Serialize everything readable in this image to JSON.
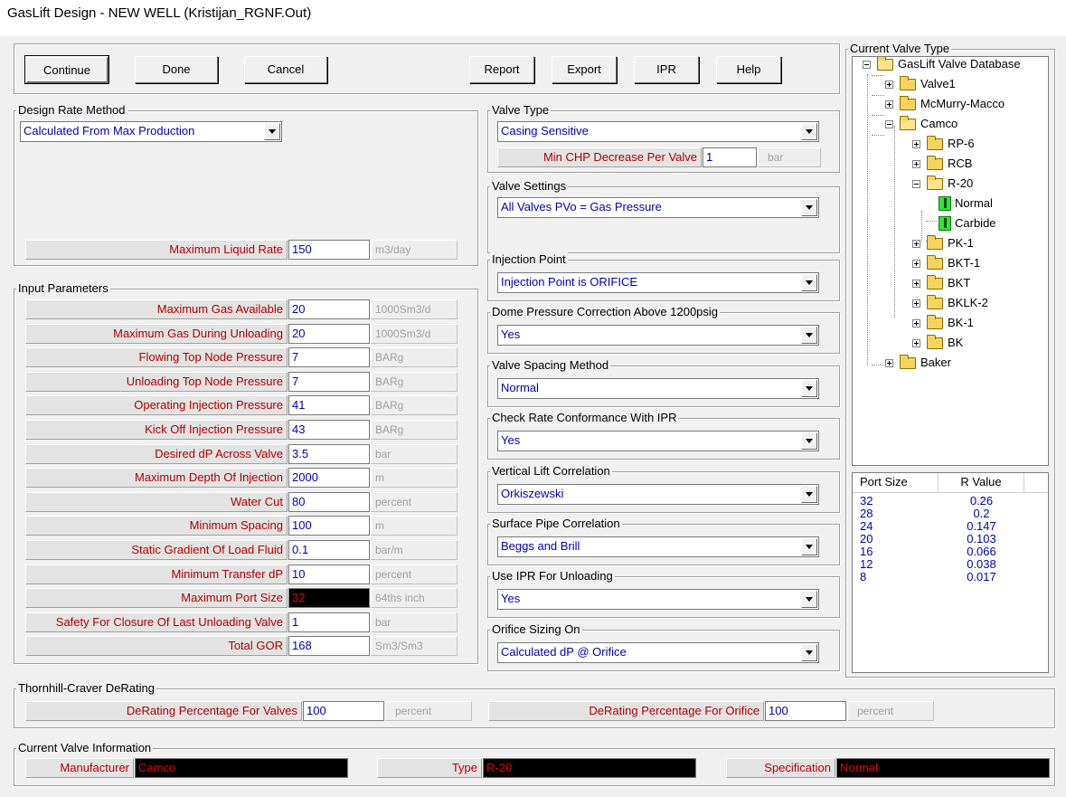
{
  "window": {
    "title": "GasLift Design - NEW WELL (Kristijan_RGNF.Out)"
  },
  "toolbar": {
    "continue": "Continue",
    "done": "Done",
    "cancel": "Cancel",
    "report": "Report",
    "export": "Export",
    "ipr": "IPR",
    "help": "Help"
  },
  "design_rate": {
    "title": "Design Rate Method",
    "method": "Calculated From Max Production",
    "max_liquid_label": "Maximum Liquid Rate",
    "max_liquid_value": "150",
    "max_liquid_unit": "m3/day"
  },
  "input_params": {
    "title": "Input Parameters",
    "rows": [
      {
        "label": "Maximum Gas Available",
        "value": "20",
        "unit": "1000Sm3/d"
      },
      {
        "label": "Maximum Gas During Unloading",
        "value": "20",
        "unit": "1000Sm3/d"
      },
      {
        "label": "Flowing Top Node Pressure",
        "value": "7",
        "unit": "BARg"
      },
      {
        "label": "Unloading Top Node Pressure",
        "value": "7",
        "unit": "BARg"
      },
      {
        "label": "Operating Injection Pressure",
        "value": "41",
        "unit": "BARg"
      },
      {
        "label": "Kick Off Injection Pressure",
        "value": "43",
        "unit": "BARg"
      },
      {
        "label": "Desired dP Across Valve",
        "value": "3.5",
        "unit": "bar"
      },
      {
        "label": "Maximum Depth Of Injection",
        "value": "2000",
        "unit": "m"
      },
      {
        "label": "Water Cut",
        "value": "80",
        "unit": "percent"
      },
      {
        "label": "Minimum Spacing",
        "value": "100",
        "unit": "m"
      },
      {
        "label": "Static Gradient Of Load Fluid",
        "value": "0.1",
        "unit": "bar/m"
      },
      {
        "label": "Minimum Transfer dP",
        "value": "10",
        "unit": "percent"
      },
      {
        "label": "Maximum Port Size",
        "value": "32",
        "unit": "64ths inch"
      },
      {
        "label": "Safety For Closure Of Last Unloading Valve",
        "value": "1",
        "unit": "bar"
      },
      {
        "label": "Total GOR",
        "value": "168",
        "unit": "Sm3/Sm3"
      }
    ]
  },
  "valve_type": {
    "title": "Valve Type",
    "value": "Casing Sensitive",
    "min_chp_label": "Min CHP Decrease Per Valve",
    "min_chp_value": "1",
    "min_chp_unit": "bar"
  },
  "valve_settings": {
    "title": "Valve Settings",
    "value": "All Valves PVo = Gas Pressure"
  },
  "injection_point": {
    "title": "Injection Point",
    "value": "Injection Point is ORIFICE"
  },
  "dome_pressure": {
    "title": "Dome Pressure Correction Above 1200psig",
    "value": "Yes"
  },
  "valve_spacing": {
    "title": "Valve Spacing Method",
    "value": "Normal"
  },
  "check_rate": {
    "title": "Check Rate Conformance With IPR",
    "value": "Yes"
  },
  "vertical_lift": {
    "title": "Vertical Lift Correlation",
    "value": "Orkiszewski"
  },
  "surface_pipe": {
    "title": "Surface Pipe Correlation",
    "value": "Beggs and Brill"
  },
  "use_ipr": {
    "title": "Use IPR For Unloading",
    "value": "Yes"
  },
  "orifice_sizing": {
    "title": "Orifice Sizing On",
    "value": "Calculated dP @ Orifice"
  },
  "valve_tree": {
    "title": "Current Valve Type",
    "root": "GasLift Valve Database",
    "valve1": "Valve1",
    "mcmurry": "McMurry-Macco",
    "camco": "Camco",
    "rp6": "RP-6",
    "rcb": "RCB",
    "r20": "R-20",
    "normal": "Normal",
    "carbide": "Carbide",
    "pk1": "PK-1",
    "bkt1": "BKT-1",
    "bkt": "BKT",
    "bklk2": "BKLK-2",
    "bk1": "BK-1",
    "bk": "BK",
    "baker": "Baker"
  },
  "port_table": {
    "headers": [
      "Port Size",
      "R Value"
    ],
    "rows": [
      [
        "32",
        "0.26"
      ],
      [
        "28",
        "0.2"
      ],
      [
        "24",
        "0.147"
      ],
      [
        "20",
        "0.103"
      ],
      [
        "16",
        "0.066"
      ],
      [
        "12",
        "0.038"
      ],
      [
        "8",
        "0.017"
      ]
    ]
  },
  "derating": {
    "title": "Thornhill-Craver DeRating",
    "valves_label": "DeRating Percentage For Valves",
    "valves_value": "100",
    "valves_unit": "percent",
    "orifice_label": "DeRating Percentage For Orifice",
    "orifice_value": "100",
    "orifice_unit": "percent"
  },
  "valve_info": {
    "title": "Current Valve Information",
    "manufacturer_label": "Manufacturer",
    "manufacturer_value": "Camco",
    "type_label": "Type",
    "type_value": "R-20",
    "spec_label": "Specification",
    "spec_value": "Normal"
  }
}
